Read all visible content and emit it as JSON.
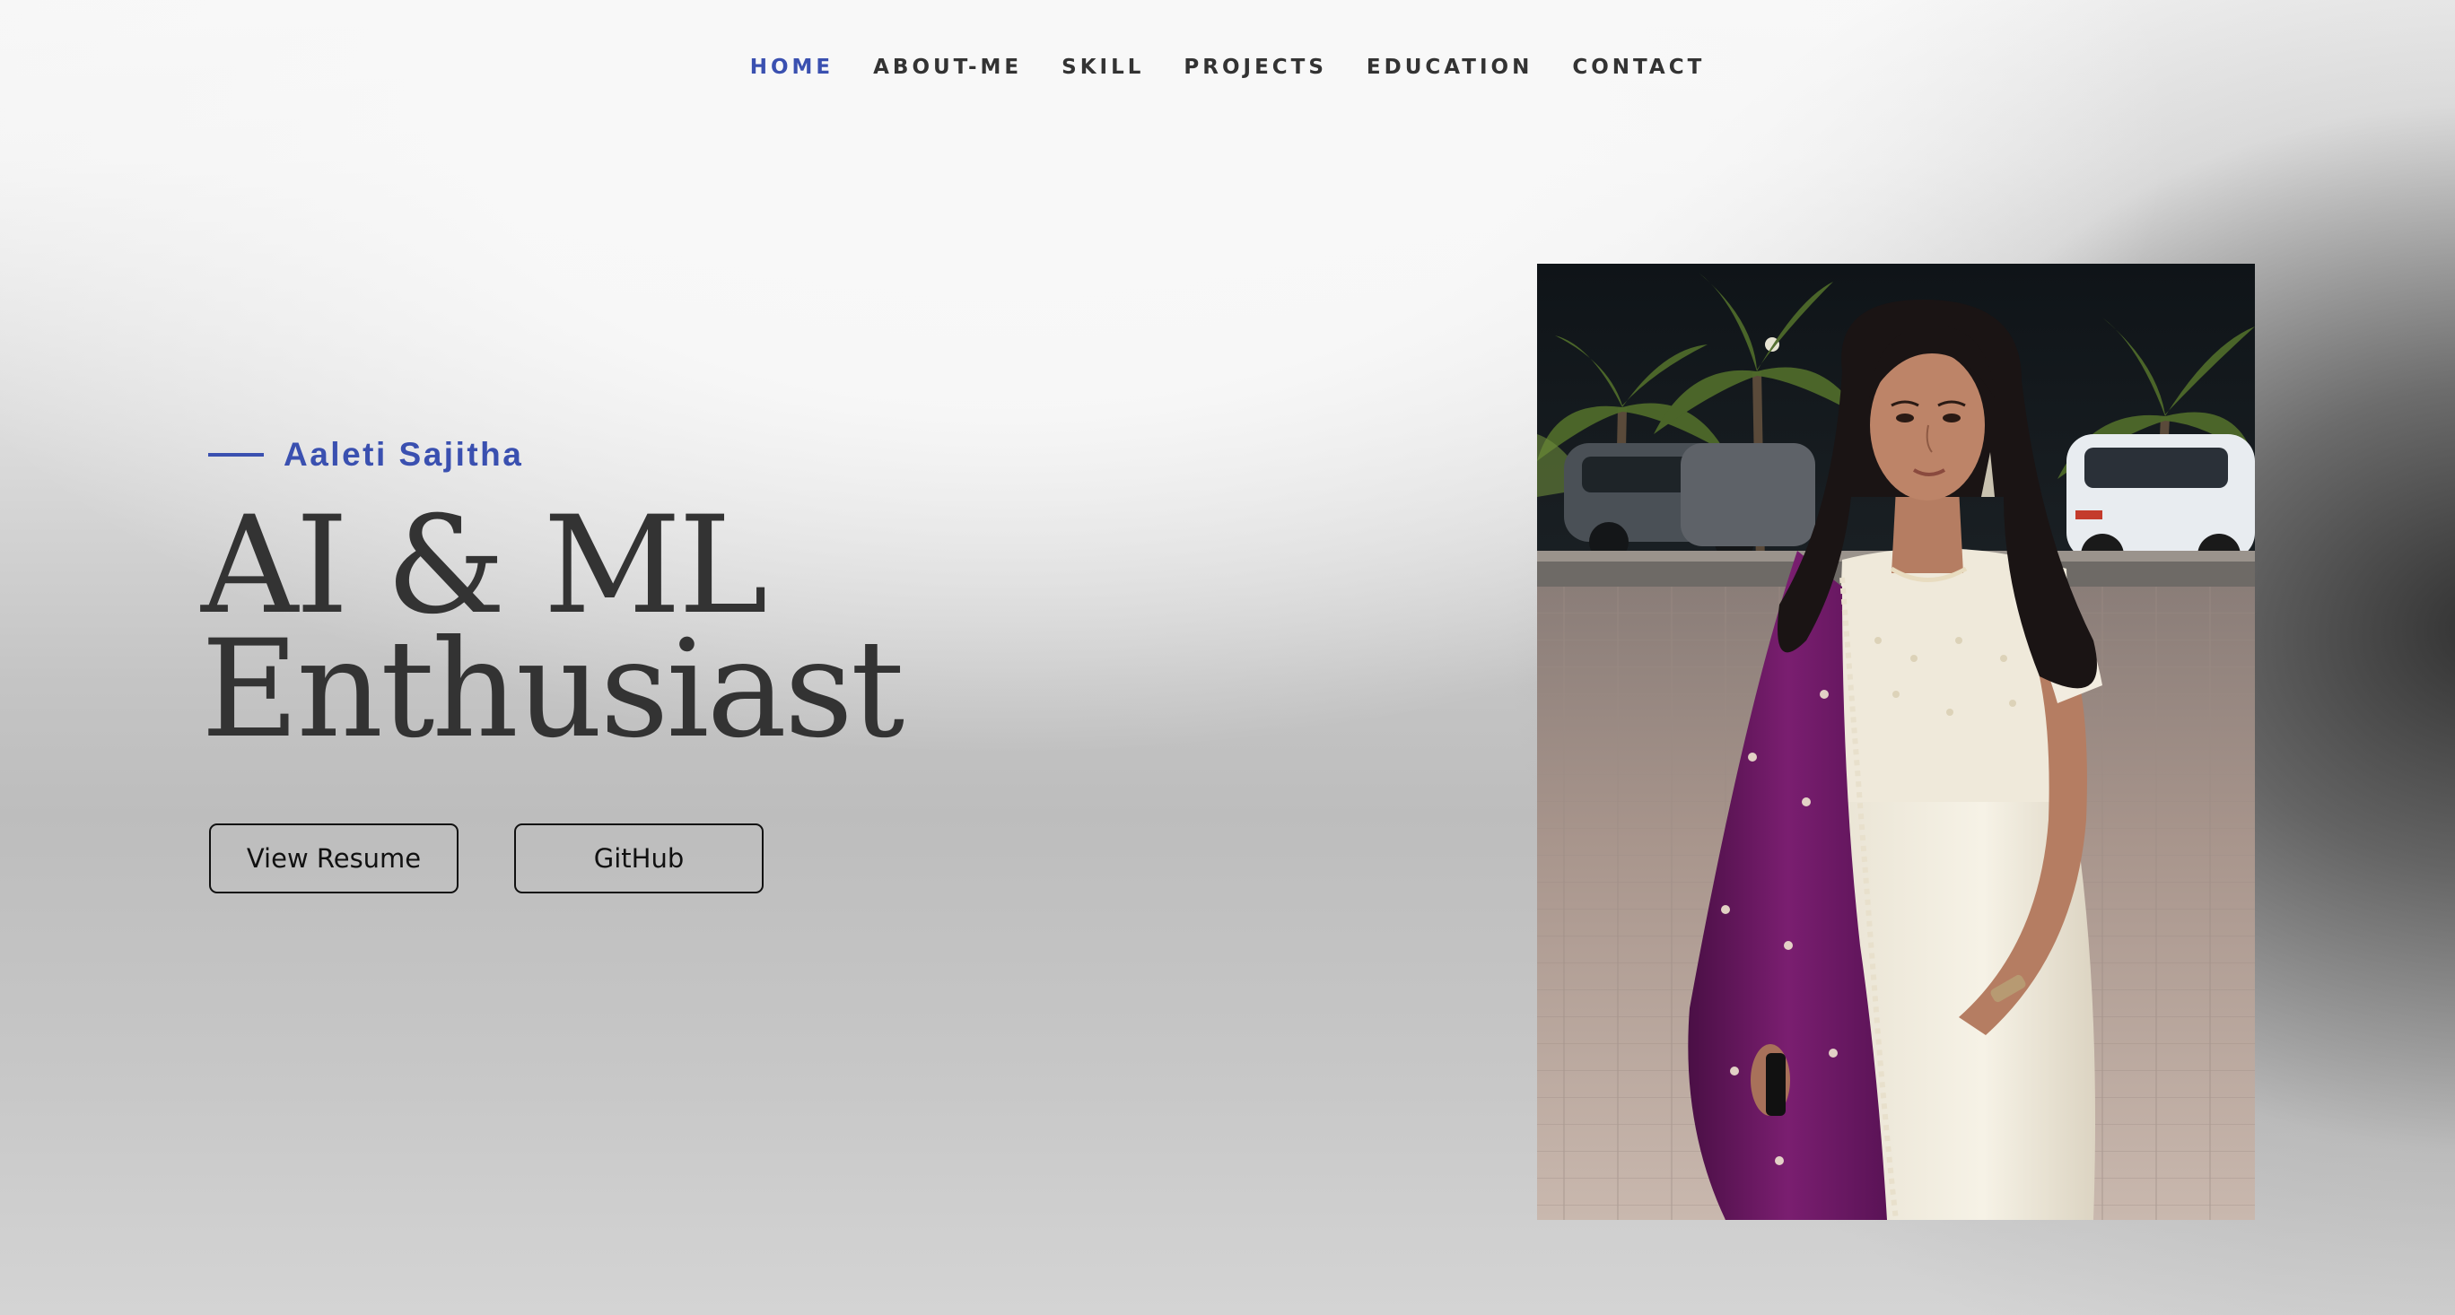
{
  "nav": {
    "items": [
      {
        "label": "HOME",
        "active": true
      },
      {
        "label": "ABOUT-ME",
        "active": false
      },
      {
        "label": "SKILL",
        "active": false
      },
      {
        "label": "PROJECTS",
        "active": false
      },
      {
        "label": "EDUCATION",
        "active": false
      },
      {
        "label": "CONTACT",
        "active": false
      }
    ]
  },
  "hero": {
    "name": "Aaleti Sajitha",
    "headline_line1": "AI & ML",
    "headline_line2": "Enthusiast",
    "buttons": {
      "resume_label": "View Resume",
      "github_label": "GitHub"
    }
  },
  "colors": {
    "accent": "#3a50b0",
    "text": "#333333",
    "button_border": "#111111"
  },
  "icons": {
    "eyebrow": "accent-line"
  }
}
